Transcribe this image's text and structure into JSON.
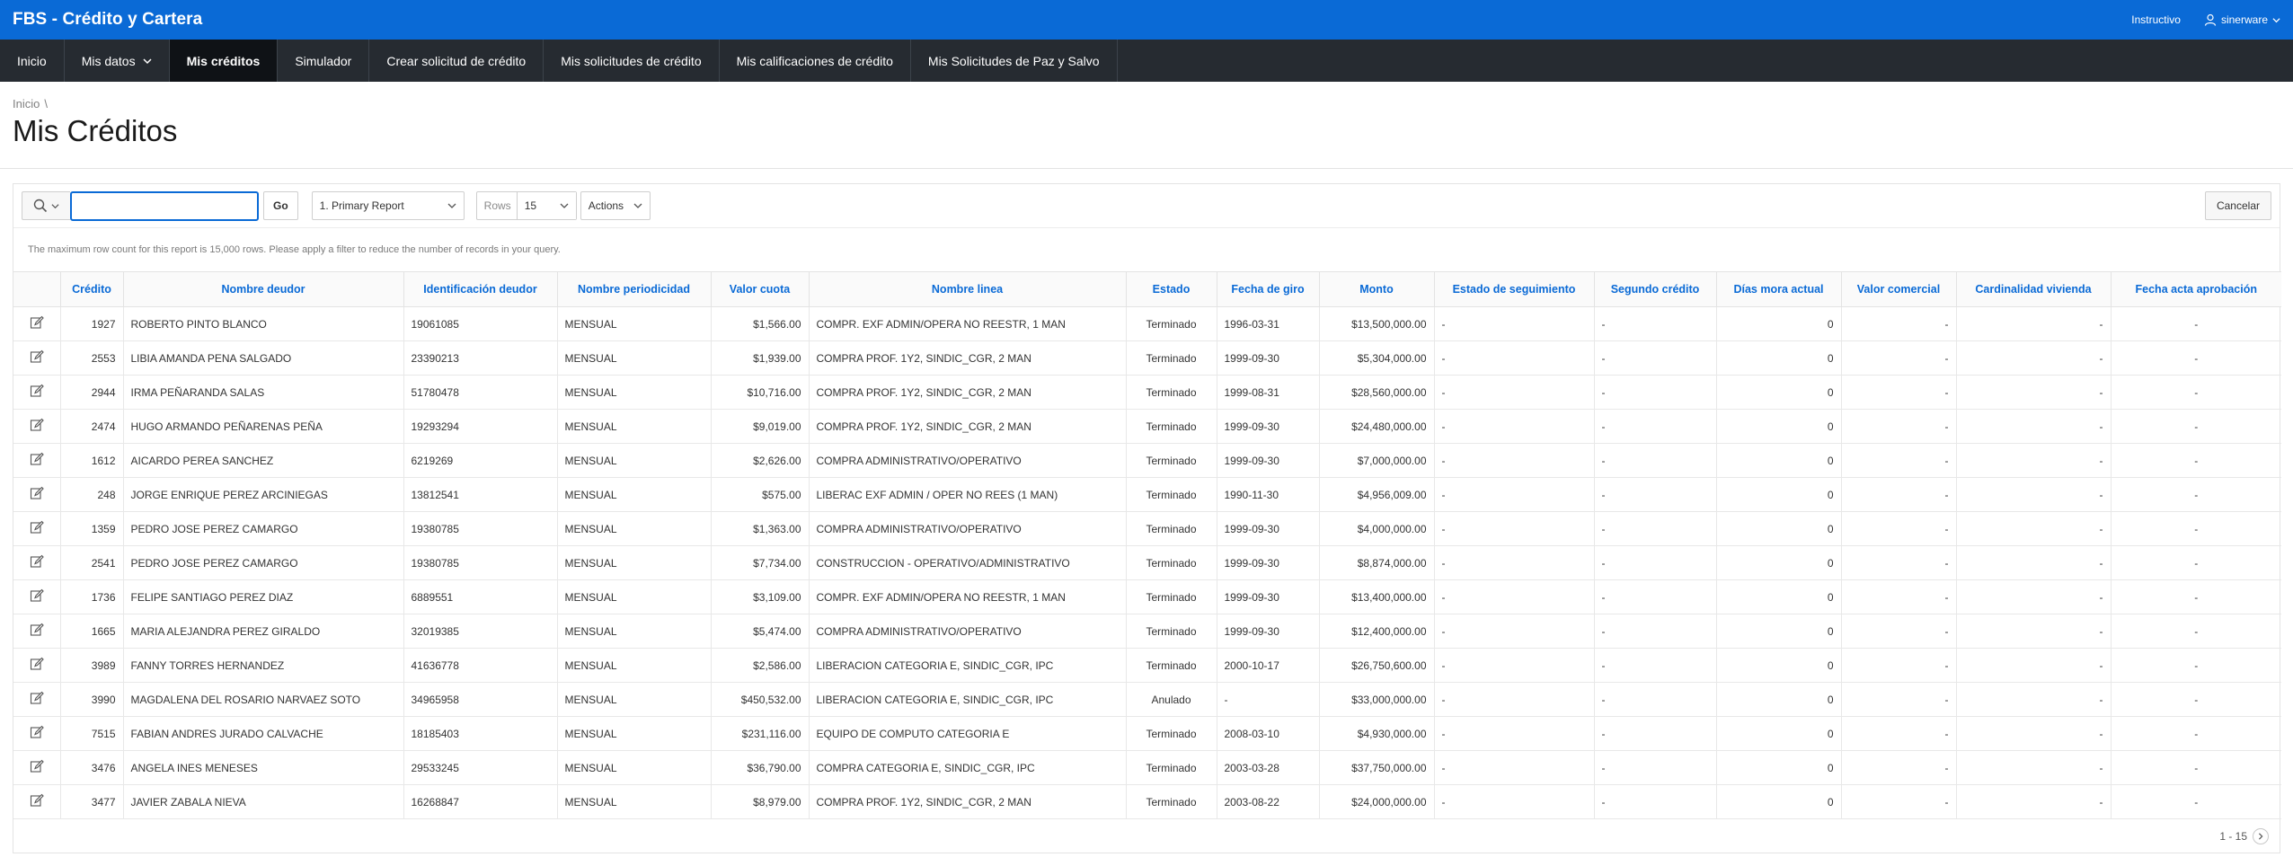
{
  "app": {
    "title": "FBS - Crédito y Cartera",
    "help_link": "Instructivo",
    "user": "sinerware"
  },
  "nav": [
    {
      "label": "Inicio",
      "active": false,
      "dropdown": false
    },
    {
      "label": "Mis datos",
      "active": false,
      "dropdown": true
    },
    {
      "label": "Mis créditos",
      "active": true,
      "dropdown": false
    },
    {
      "label": "Simulador",
      "active": false,
      "dropdown": false
    },
    {
      "label": "Crear solicitud de crédito",
      "active": false,
      "dropdown": false
    },
    {
      "label": "Mis solicitudes de crédito",
      "active": false,
      "dropdown": false
    },
    {
      "label": "Mis calificaciones de crédito",
      "active": false,
      "dropdown": false
    },
    {
      "label": "Mis Solicitudes de Paz y Salvo",
      "active": false,
      "dropdown": false
    }
  ],
  "breadcrumb": {
    "home": "Inicio",
    "separator": "\\"
  },
  "page": {
    "title": "Mis Créditos"
  },
  "toolbar": {
    "search_value": "",
    "go_label": "Go",
    "report_value": "1. Primary Report",
    "rows_label": "Rows",
    "rows_value": "15",
    "actions_label": "Actions",
    "cancel_label": "Cancelar"
  },
  "notice": "The maximum row count for this report is 15,000 rows. Please apply a filter to reduce the number of records in your query.",
  "table": {
    "columns": [
      "Crédito",
      "Nombre deudor",
      "Identificación deudor",
      "Nombre periodicidad",
      "Valor cuota",
      "Nombre linea",
      "Estado",
      "Fecha de giro",
      "Monto",
      "Estado de seguimiento",
      "Segundo crédito",
      "Días mora actual",
      "Valor comercial",
      "Cardinalidad vivienda",
      "Fecha acta aprobación"
    ],
    "rows": [
      [
        "1927",
        "ROBERTO PINTO BLANCO",
        "19061085",
        "MENSUAL",
        "$1,566.00",
        "COMPR. EXF ADMIN/OPERA NO REESTR, 1 MAN",
        "Terminado",
        "1996-03-31",
        "$13,500,000.00",
        "-",
        "-",
        "0",
        "-",
        "-",
        "-"
      ],
      [
        "2553",
        "LIBIA AMANDA PENA SALGADO",
        "23390213",
        "MENSUAL",
        "$1,939.00",
        "COMPRA PROF. 1Y2, SINDIC_CGR, 2 MAN",
        "Terminado",
        "1999-09-30",
        "$5,304,000.00",
        "-",
        "-",
        "0",
        "-",
        "-",
        "-"
      ],
      [
        "2944",
        "IRMA PEÑARANDA SALAS",
        "51780478",
        "MENSUAL",
        "$10,716.00",
        "COMPRA PROF. 1Y2, SINDIC_CGR, 2 MAN",
        "Terminado",
        "1999-08-31",
        "$28,560,000.00",
        "-",
        "-",
        "0",
        "-",
        "-",
        "-"
      ],
      [
        "2474",
        "HUGO ARMANDO PEÑARENAS PEÑA",
        "19293294",
        "MENSUAL",
        "$9,019.00",
        "COMPRA PROF. 1Y2, SINDIC_CGR, 2 MAN",
        "Terminado",
        "1999-09-30",
        "$24,480,000.00",
        "-",
        "-",
        "0",
        "-",
        "-",
        "-"
      ],
      [
        "1612",
        "AICARDO PEREA SANCHEZ",
        "6219269",
        "MENSUAL",
        "$2,626.00",
        "COMPRA ADMINISTRATIVO/OPERATIVO",
        "Terminado",
        "1999-09-30",
        "$7,000,000.00",
        "-",
        "-",
        "0",
        "-",
        "-",
        "-"
      ],
      [
        "248",
        "JORGE ENRIQUE PEREZ ARCINIEGAS",
        "13812541",
        "MENSUAL",
        "$575.00",
        "LIBERAC EXF ADMIN / OPER NO REES (1 MAN)",
        "Terminado",
        "1990-11-30",
        "$4,956,009.00",
        "-",
        "-",
        "0",
        "-",
        "-",
        "-"
      ],
      [
        "1359",
        "PEDRO JOSE PEREZ CAMARGO",
        "19380785",
        "MENSUAL",
        "$1,363.00",
        "COMPRA ADMINISTRATIVO/OPERATIVO",
        "Terminado",
        "1999-09-30",
        "$4,000,000.00",
        "-",
        "-",
        "0",
        "-",
        "-",
        "-"
      ],
      [
        "2541",
        "PEDRO JOSE PEREZ CAMARGO",
        "19380785",
        "MENSUAL",
        "$7,734.00",
        "CONSTRUCCION - OPERATIVO/ADMINISTRATIVO",
        "Terminado",
        "1999-09-30",
        "$8,874,000.00",
        "-",
        "-",
        "0",
        "-",
        "-",
        "-"
      ],
      [
        "1736",
        "FELIPE SANTIAGO PEREZ DIAZ",
        "6889551",
        "MENSUAL",
        "$3,109.00",
        "COMPR. EXF ADMIN/OPERA NO REESTR, 1 MAN",
        "Terminado",
        "1999-09-30",
        "$13,400,000.00",
        "-",
        "-",
        "0",
        "-",
        "-",
        "-"
      ],
      [
        "1665",
        "MARIA ALEJANDRA PEREZ GIRALDO",
        "32019385",
        "MENSUAL",
        "$5,474.00",
        "COMPRA ADMINISTRATIVO/OPERATIVO",
        "Terminado",
        "1999-09-30",
        "$12,400,000.00",
        "-",
        "-",
        "0",
        "-",
        "-",
        "-"
      ],
      [
        "3989",
        "FANNY TORRES HERNANDEZ",
        "41636778",
        "MENSUAL",
        "$2,586.00",
        "LIBERACION CATEGORIA E, SINDIC_CGR, IPC",
        "Terminado",
        "2000-10-17",
        "$26,750,600.00",
        "-",
        "-",
        "0",
        "-",
        "-",
        "-"
      ],
      [
        "3990",
        "MAGDALENA DEL ROSARIO NARVAEZ SOTO",
        "34965958",
        "MENSUAL",
        "$450,532.00",
        "LIBERACION CATEGORIA E, SINDIC_CGR, IPC",
        "Anulado",
        "-",
        "$33,000,000.00",
        "-",
        "-",
        "0",
        "-",
        "-",
        "-"
      ],
      [
        "7515",
        "FABIAN ANDRES JURADO CALVACHE",
        "18185403",
        "MENSUAL",
        "$231,116.00",
        "EQUIPO DE COMPUTO CATEGORIA E",
        "Terminado",
        "2008-03-10",
        "$4,930,000.00",
        "-",
        "-",
        "0",
        "-",
        "-",
        "-"
      ],
      [
        "3476",
        "ANGELA INES MENESES",
        "29533245",
        "MENSUAL",
        "$36,790.00",
        "COMPRA CATEGORIA E, SINDIC_CGR, IPC",
        "Terminado",
        "2003-03-28",
        "$37,750,000.00",
        "-",
        "-",
        "0",
        "-",
        "-",
        "-"
      ],
      [
        "3477",
        "JAVIER ZABALA NIEVA",
        "16268847",
        "MENSUAL",
        "$8,979.00",
        "COMPRA PROF. 1Y2, SINDIC_CGR, 2 MAN",
        "Terminado",
        "2003-08-22",
        "$24,000,000.00",
        "-",
        "-",
        "0",
        "-",
        "-",
        "-"
      ]
    ]
  },
  "pagination": {
    "range": "1 - 15"
  },
  "colors": {
    "topbar": "#0a6ad6",
    "navbar": "#262b31",
    "nav_active": "#0f1216",
    "link": "#0a6ad6"
  },
  "icons": {
    "user": "user-icon",
    "chevron": "chevron-down-icon",
    "search": "search-icon",
    "edit": "edit-icon",
    "next": "chevron-right-icon"
  }
}
